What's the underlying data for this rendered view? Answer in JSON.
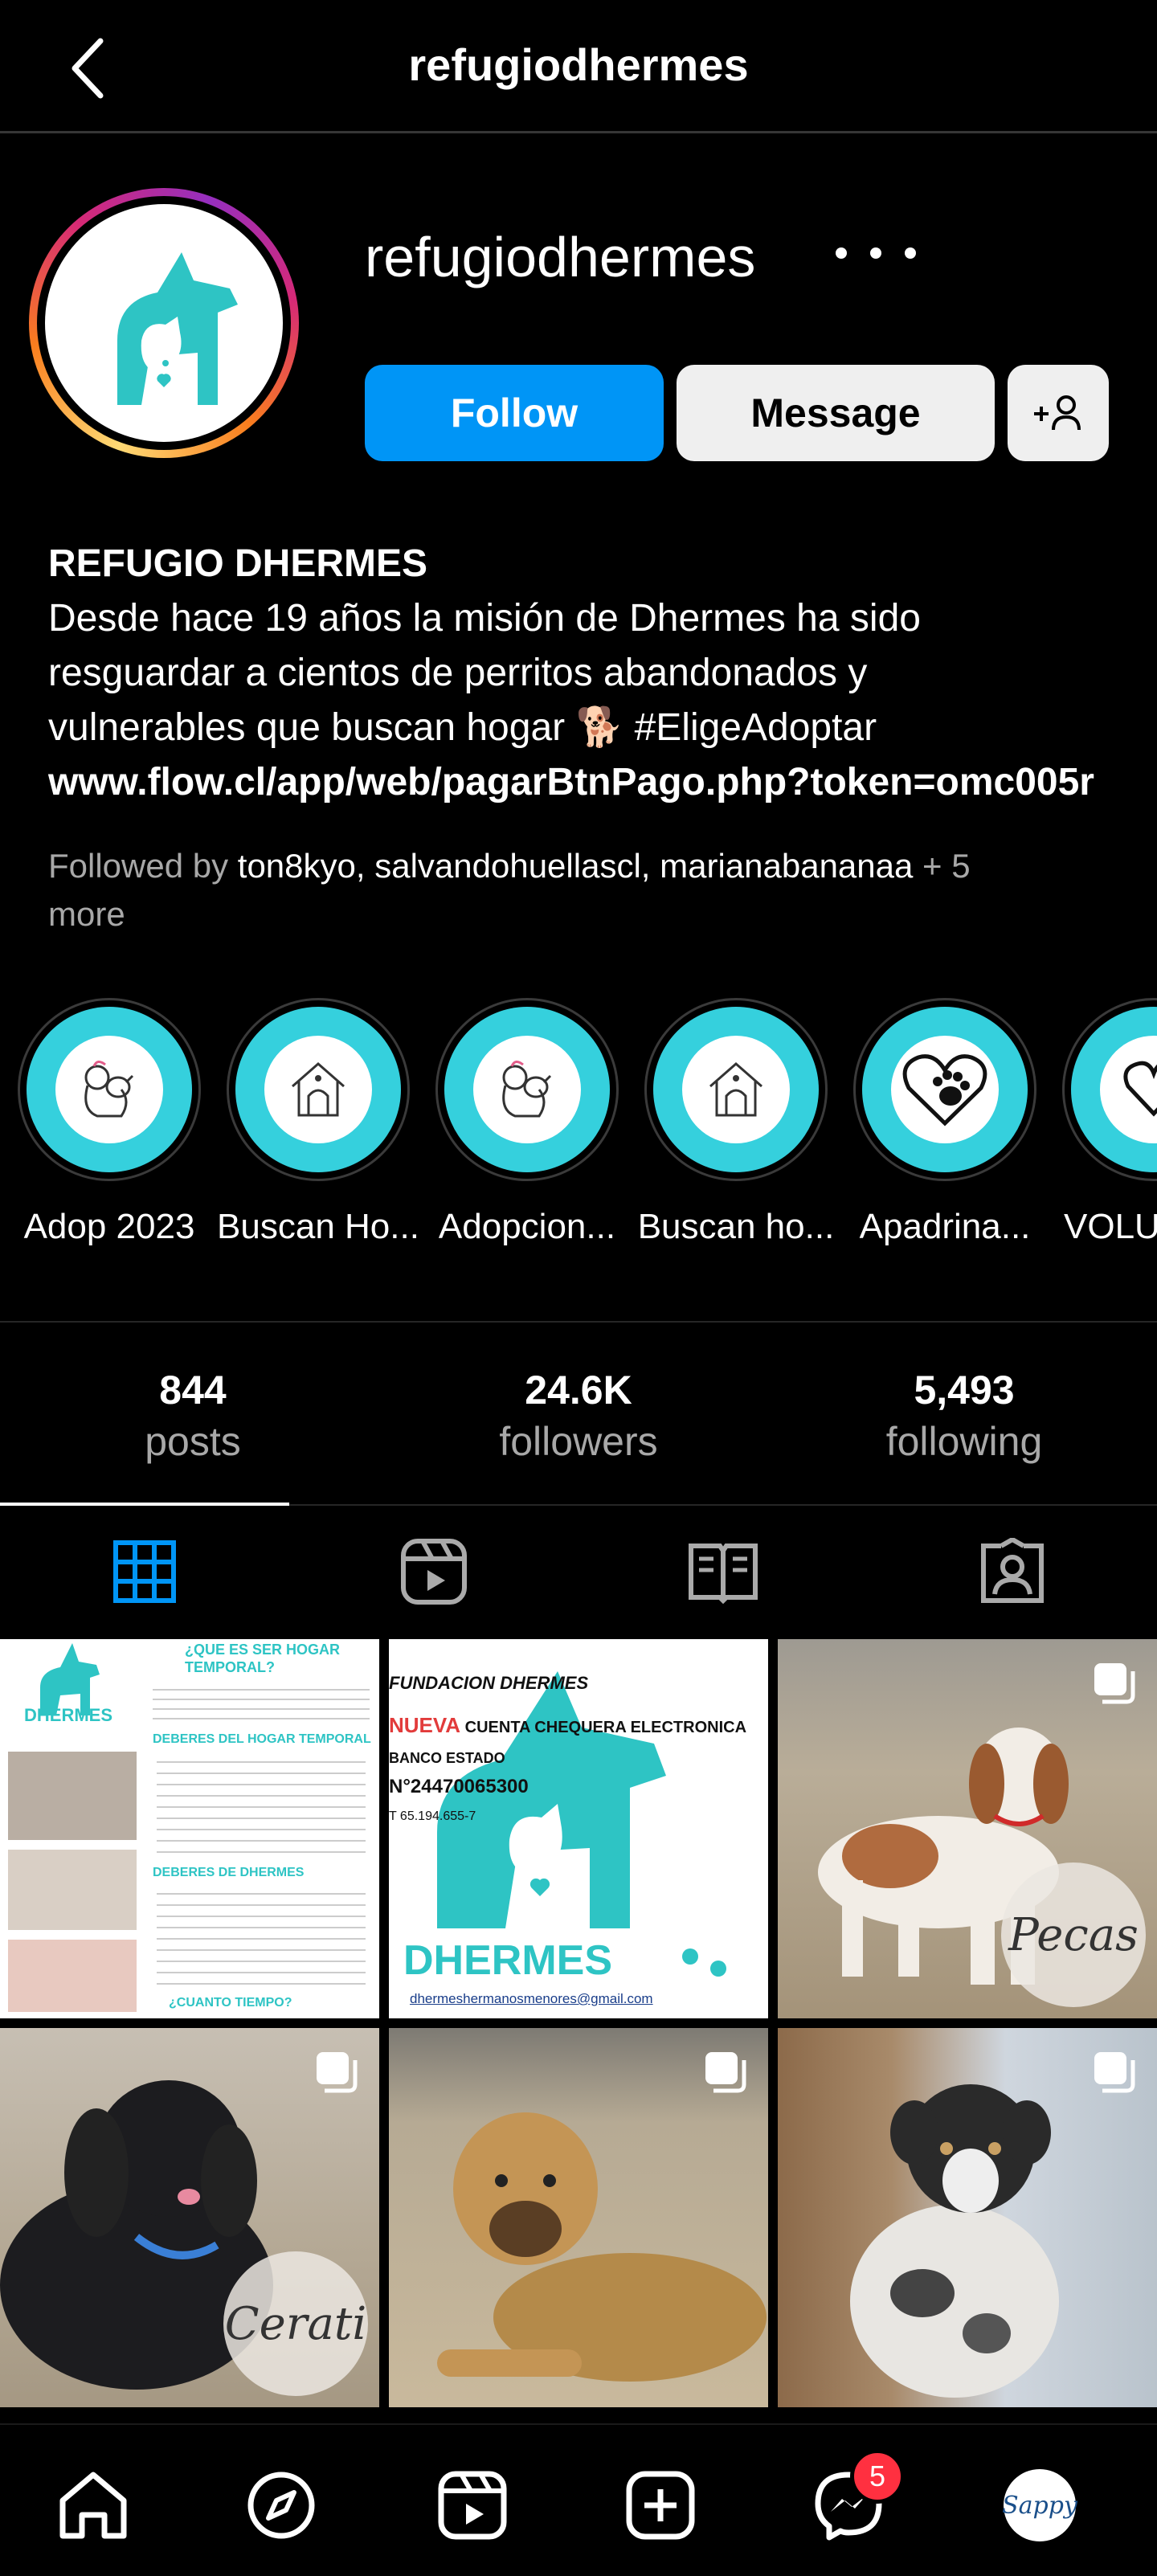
{
  "topbar": {
    "title": "refugiodhermes"
  },
  "profile": {
    "username": "refugiodhermes",
    "follow_label": "Follow",
    "message_label": "Message"
  },
  "bio": {
    "name": "REFUGIO DHERMES",
    "text": "Desde hace 19 años la misión de Dhermes ha sido resguardar a cientos de perritos abandonados y vulnerables que buscan hogar 🐕 #EligeAdoptar",
    "link": "www.flow.cl/app/web/pagarBtnPago.php?token=omc005r"
  },
  "followed_by": {
    "prefix": "Followed by",
    "names": "ton8kyo, salvandohuellascl, marianabananaa",
    "suffix": "+ 5 more"
  },
  "highlights": [
    {
      "label": "Adop 2023",
      "icon": "hug-dog-icon"
    },
    {
      "label": "Buscan Ho...",
      "icon": "dog-house-icon"
    },
    {
      "label": "Adopcion...",
      "icon": "hug-dog-icon"
    },
    {
      "label": "Buscan ho...",
      "icon": "dog-house-icon"
    },
    {
      "label": "Apadrina...",
      "icon": "paw-heart-icon"
    },
    {
      "label": "VOLU",
      "icon": "heart-icon"
    }
  ],
  "stats": {
    "posts": {
      "value": "844",
      "label": "posts"
    },
    "followers": {
      "value": "24.6K",
      "label": "followers"
    },
    "following": {
      "value": "5,493",
      "label": "following"
    }
  },
  "posts": [
    {
      "kind": "flyer-hogar-temporal",
      "heading": "¿QUE ES SER HOGAR TEMPORAL?",
      "sub": "DEBERES DEL HOGAR TEMPORAL",
      "sub2": "DEBERES DE DHERMES",
      "sub3": "¿CUANTO TIEMPO?",
      "logo": "DHERMES"
    },
    {
      "kind": "flyer-cuenta",
      "line1": "FUNDACION DHERMES",
      "line2a": "NUEVA",
      "line2b": " CUENTA CHEQUERA ELECTRONICA",
      "line3": "BANCO ESTADO",
      "line4": "N°24470065300",
      "line5": "T  65.194.655-7",
      "brand": "DHERMES",
      "email": "dhermeshermanosmenores@gmail.com"
    },
    {
      "kind": "photo",
      "name": "Pecas"
    },
    {
      "kind": "photo",
      "name": "Cerati"
    },
    {
      "kind": "photo",
      "name": ""
    },
    {
      "kind": "photo",
      "name": ""
    }
  ],
  "nav": {
    "messages_badge": "5",
    "profile_label": "Sappy"
  },
  "colors": {
    "accent": "#0095f6",
    "teal": "#35d0dd",
    "badge": "#ff3040"
  }
}
